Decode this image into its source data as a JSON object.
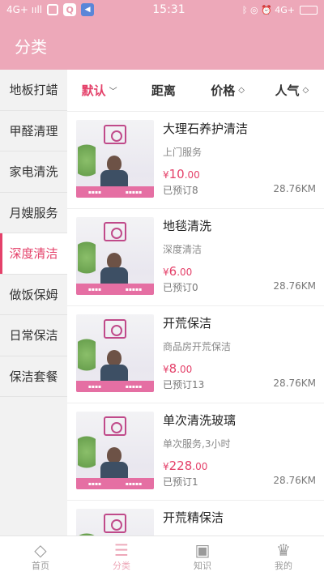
{
  "status_bar": {
    "network": "4G+ ııll",
    "time": "15:31",
    "right": "ᛒ ◎ ⏰ 4G+"
  },
  "app_bar": {
    "title": "分类"
  },
  "sidebar": {
    "items": [
      {
        "label": "地板打蜡",
        "active": false
      },
      {
        "label": "甲醛清理",
        "active": false
      },
      {
        "label": "家电清洗",
        "active": false
      },
      {
        "label": "月嫂服务",
        "active": false
      },
      {
        "label": "深度清洁",
        "active": true
      },
      {
        "label": "做饭保姆",
        "active": false
      },
      {
        "label": "日常保洁",
        "active": false
      },
      {
        "label": "保洁套餐",
        "active": false
      }
    ]
  },
  "sort_bar": {
    "default_label": "默认",
    "distance_label": "距离",
    "price_label": "价格",
    "popularity_label": "人气"
  },
  "listings": [
    {
      "title": "大理石养护清洁",
      "subtitle": "上门服务",
      "currency": "¥",
      "price_int": "10",
      "price_dec": ".00",
      "booked": "已预订8",
      "distance": "28.76KM"
    },
    {
      "title": "地毯清洗",
      "subtitle": "深度清洁",
      "currency": "¥",
      "price_int": "6",
      "price_dec": ".00",
      "booked": "已预订0",
      "distance": "28.76KM"
    },
    {
      "title": "开荒保洁",
      "subtitle": "商品房开荒保洁",
      "currency": "¥",
      "price_int": "8",
      "price_dec": ".00",
      "booked": "已预订13",
      "distance": "28.76KM"
    },
    {
      "title": "单次清洗玻璃",
      "subtitle": "单次服务,3小时",
      "currency": "¥",
      "price_int": "228",
      "price_dec": ".00",
      "booked": "已预订1",
      "distance": "28.76KM"
    },
    {
      "title": "开荒精保洁",
      "subtitle": "",
      "currency": "",
      "price_int": "",
      "price_dec": "",
      "booked": "",
      "distance": ""
    }
  ],
  "tab_bar": {
    "items": [
      {
        "label": "首页",
        "icon": "diamond-icon"
      },
      {
        "label": "分类",
        "icon": "list-icon",
        "active": true
      },
      {
        "label": "知识",
        "icon": "book-icon"
      },
      {
        "label": "我的",
        "icon": "crown-icon"
      }
    ]
  },
  "colors": {
    "accent": "#e4416a",
    "brand_pink": "#eda8b9"
  }
}
